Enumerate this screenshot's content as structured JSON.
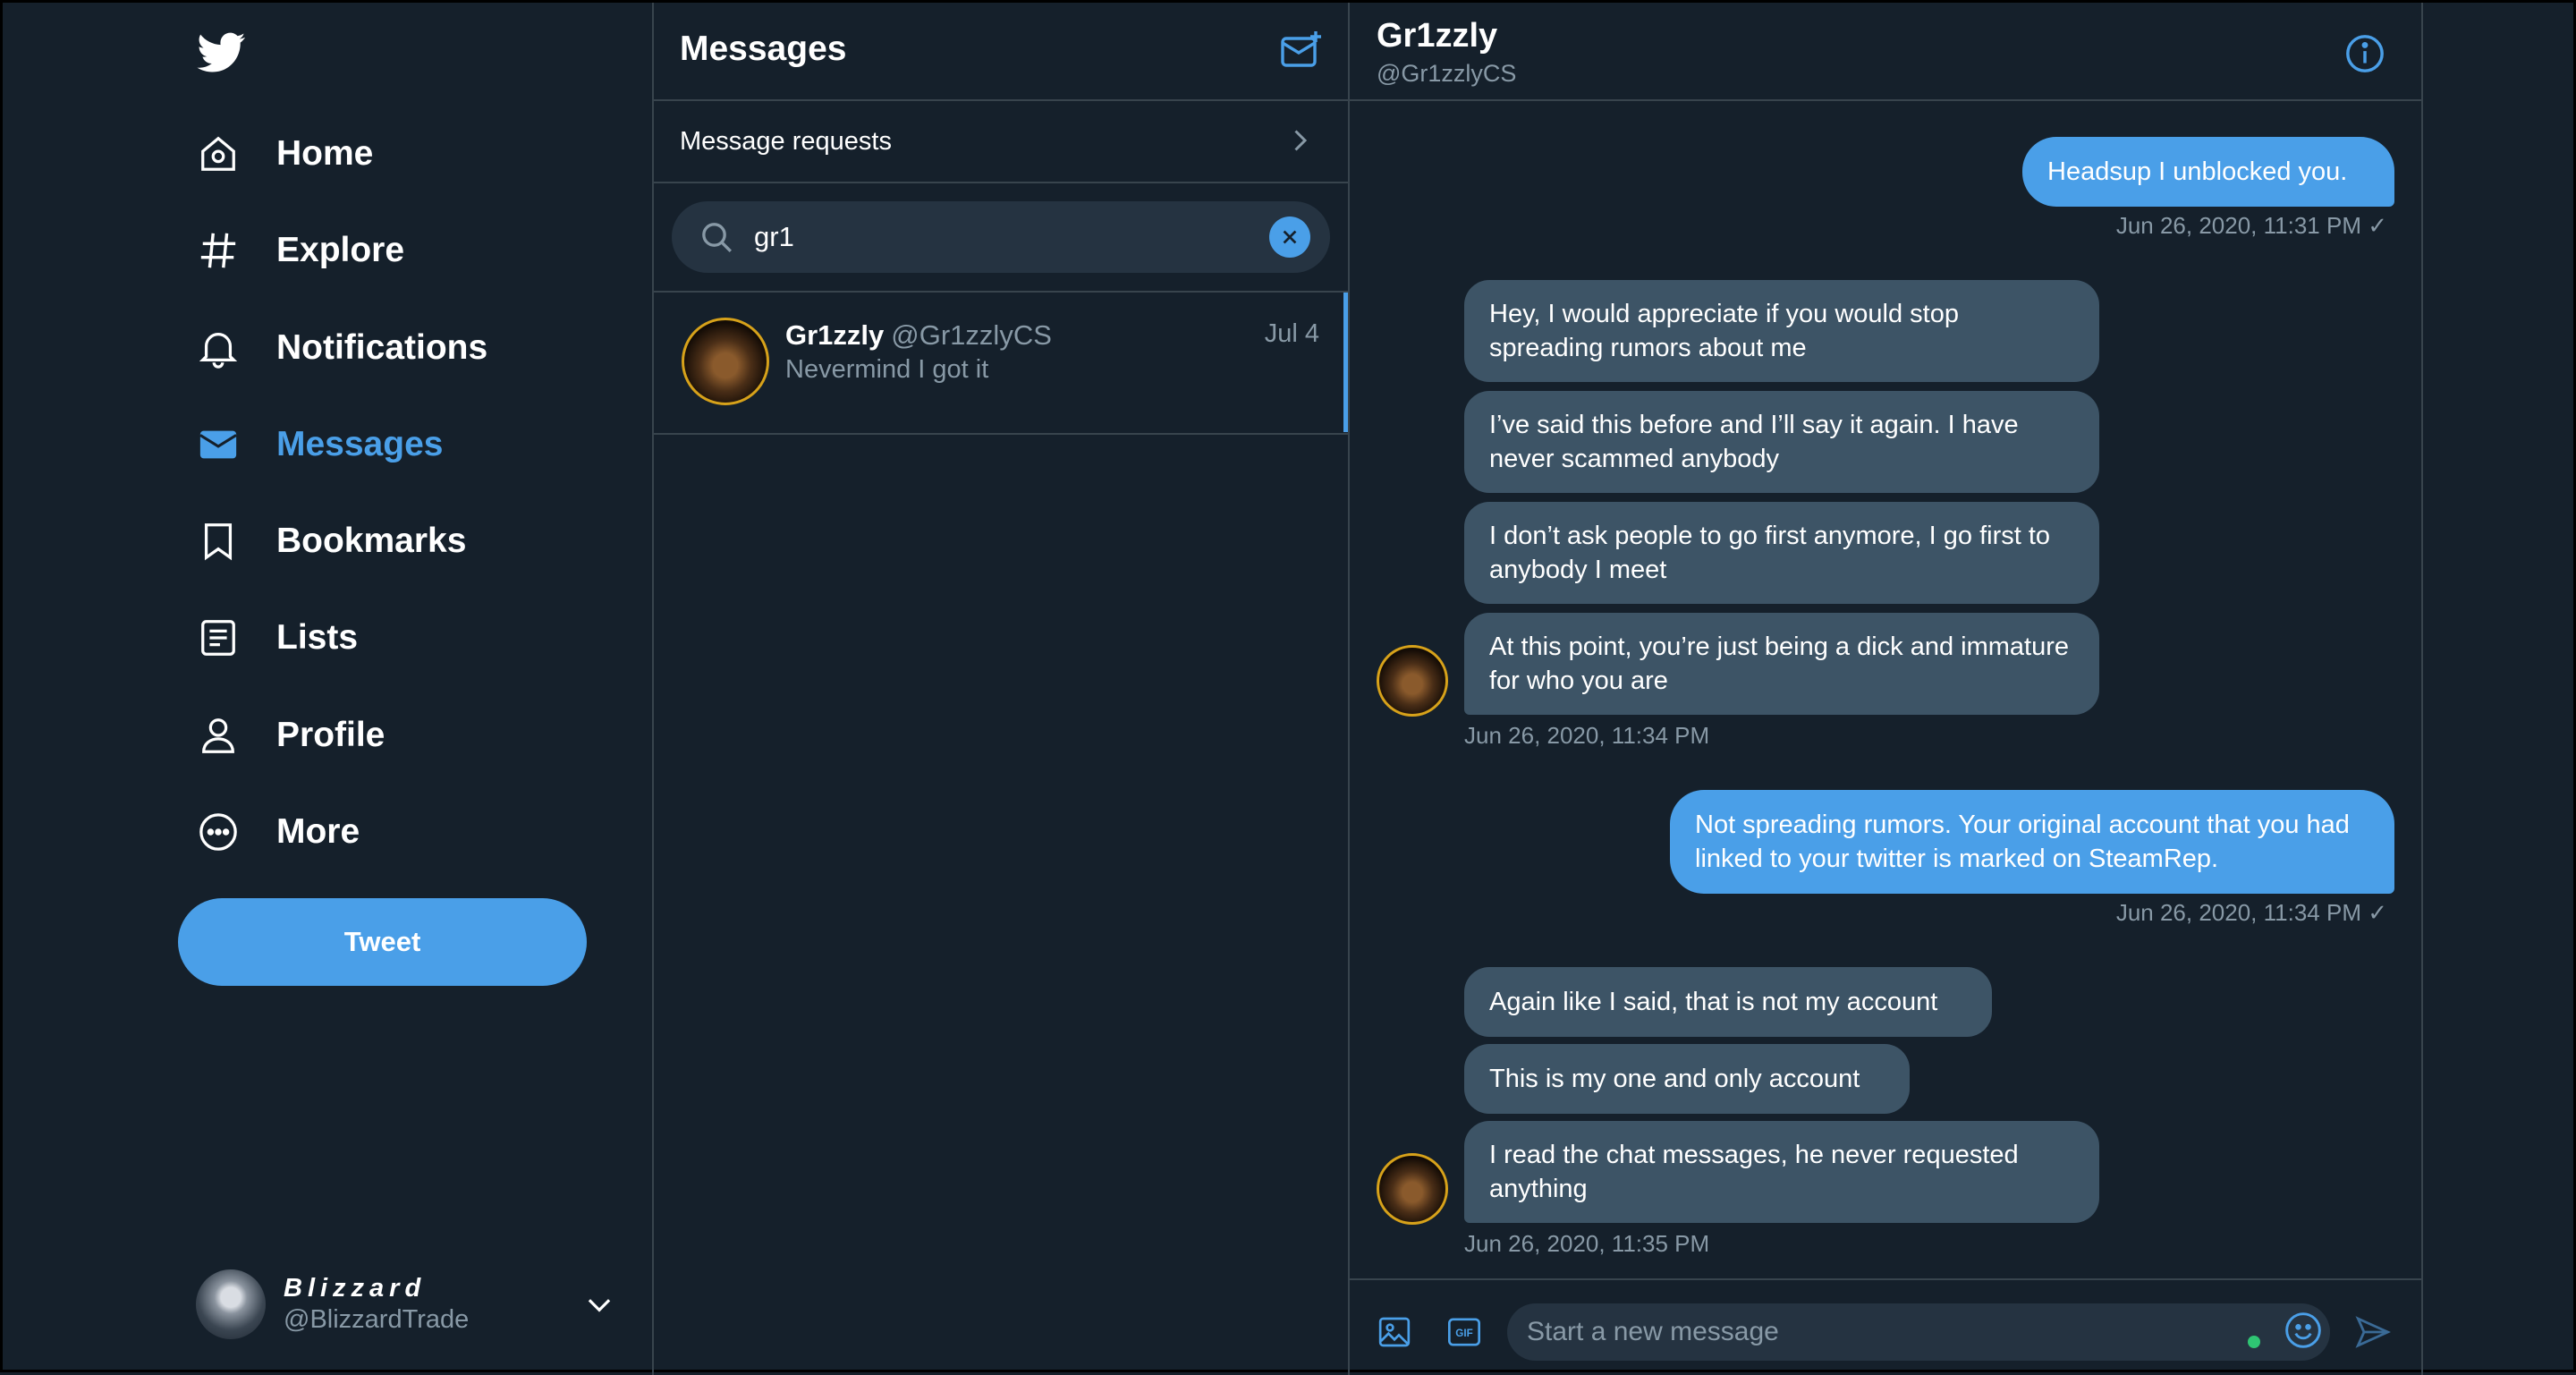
{
  "colors": {
    "background": "#15202b",
    "accent": "#4a9fe8",
    "bubble_incoming": "#3d5466",
    "muted_text": "#8899a6",
    "divider": "#38444d"
  },
  "nav": {
    "logo_icon": "twitter-bird-icon",
    "items": [
      {
        "label": "Home",
        "icon": "home-icon"
      },
      {
        "label": "Explore",
        "icon": "hashtag-icon"
      },
      {
        "label": "Notifications",
        "icon": "bell-icon"
      },
      {
        "label": "Messages",
        "icon": "envelope-icon",
        "active": true
      },
      {
        "label": "Bookmarks",
        "icon": "bookmark-icon"
      },
      {
        "label": "Lists",
        "icon": "list-icon"
      },
      {
        "label": "Profile",
        "icon": "person-icon"
      },
      {
        "label": "More",
        "icon": "more-icon"
      }
    ],
    "tweet_button": "Tweet",
    "account": {
      "display_name": "Blizzard",
      "handle": "@BlizzardTrade"
    }
  },
  "messages_panel": {
    "title": "Messages",
    "message_requests": "Message requests",
    "search": {
      "value": "gr1"
    },
    "conversations": [
      {
        "name": "Gr1zzly",
        "handle": "@Gr1zzlyCS",
        "date": "Jul 4",
        "preview": "Nevermind I got it"
      }
    ]
  },
  "chat": {
    "name": "Gr1zzly",
    "handle": "@Gr1zzlyCS",
    "messages": [
      {
        "from": "me",
        "text": "Headsup I unblocked you."
      },
      {
        "from": "them",
        "text": "Hey, I would appreciate if you would stop spreading rumors about me"
      },
      {
        "from": "them",
        "text": "I’ve said this before and I’ll say it again. I have never scammed anybody"
      },
      {
        "from": "them",
        "text": "I don’t ask people to go first anymore, I go first to anybody I meet"
      },
      {
        "from": "them",
        "text": "At this point, you’re just being a dick and immature for who you are"
      },
      {
        "from": "me",
        "text": "Not spreading rumors. Your original account that you had linked to your twitter is marked on SteamRep."
      },
      {
        "from": "them",
        "text": "Again like I said, that is not my account"
      },
      {
        "from": "them",
        "text": "This is my one and only account"
      },
      {
        "from": "them",
        "text": "I read the chat messages, he never requested anything"
      }
    ],
    "timestamps": {
      "t1": "Jun 26, 2020, 11:31 PM ✓",
      "t2": "Jun 26, 2020, 11:34 PM",
      "t3": "Jun 26, 2020, 11:34 PM ✓",
      "t4": "Jun 26, 2020, 11:35 PM"
    },
    "composer": {
      "placeholder": "Start a new message",
      "gif_label": "GIF"
    }
  }
}
